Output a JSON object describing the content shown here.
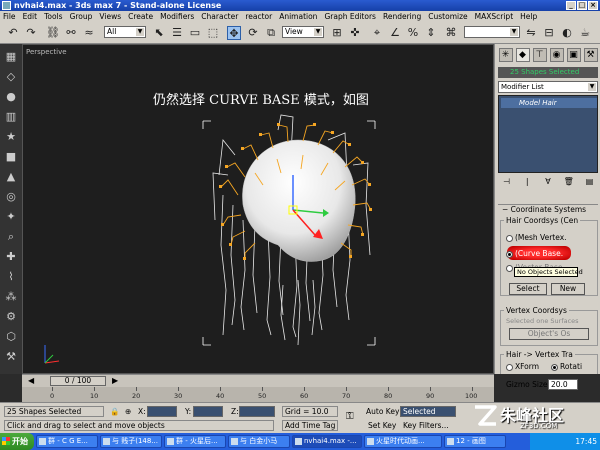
{
  "window": {
    "title": "nvhai4.max - 3ds max 7  - Stand-alone License"
  },
  "menu": [
    "File",
    "Edit",
    "Tools",
    "Group",
    "Views",
    "Create",
    "Modifiers",
    "Character",
    "reactor",
    "Animation",
    "Graph Editors",
    "Rendering",
    "Customize",
    "MAXScript",
    "Help"
  ],
  "toolbar": {
    "selection_filter": "All",
    "ref_coord": "View"
  },
  "viewport": {
    "label": "Perspective",
    "caption": "仍然选择 CURVE BASE 模式，如图"
  },
  "command_panel": {
    "selection_info": "25 Shapes Selected",
    "modifier_list": "Modifier List",
    "stack_item": "Model Hair",
    "rollout_title": "Coordinate Systems",
    "hair_coordsys_group": "Hair Coordsys (Cen",
    "radio_mesh": "(Mesh Vertex.",
    "radio_curve": "(Curve Base.",
    "radio_vector": "(Vector Base",
    "tooltip": "No Objects Selected",
    "select_button": "Select",
    "new_button": "New",
    "vertex_coordsys_group": "Vertex Coordsys",
    "vertex_hint": "Selected one Surfaces",
    "object_button": "Object's Os",
    "hair_vertex_group": "Hair -> Vertex Tra",
    "radio_xform": "XForm",
    "radio_rotate": "Rotati",
    "gizmo_label": "Gizmo Size",
    "gizmo_value": "20.0"
  },
  "timeline": {
    "frame": "0 / 100",
    "ticks": [
      "0",
      "10",
      "20",
      "30",
      "40",
      "50",
      "60",
      "70",
      "80",
      "90",
      "100"
    ]
  },
  "status": {
    "selection": "25 Shapes Selected",
    "prompt": "Click and drag to select and move objects",
    "x_label": "X:",
    "y_label": "Y:",
    "z_label": "Z:",
    "grid": "Grid = 10.0",
    "add_time_tag": "Add Time Tag",
    "auto_key": "Auto Key",
    "set_key": "Set Key",
    "key_mode": "Selected",
    "key_filters": "Key Filters..."
  },
  "taskbar": {
    "start": "开始",
    "buttons": [
      "群 - C G E...",
      "与 贱子(148...",
      "群 - 火星后...",
      "与 白金小马",
      "nvhai4.max -...",
      "火星时代动画...",
      "12 - 画图"
    ],
    "clock": "17:45"
  },
  "watermark": {
    "main": "朱峰社区",
    "sub": "ZF3D.COM"
  }
}
